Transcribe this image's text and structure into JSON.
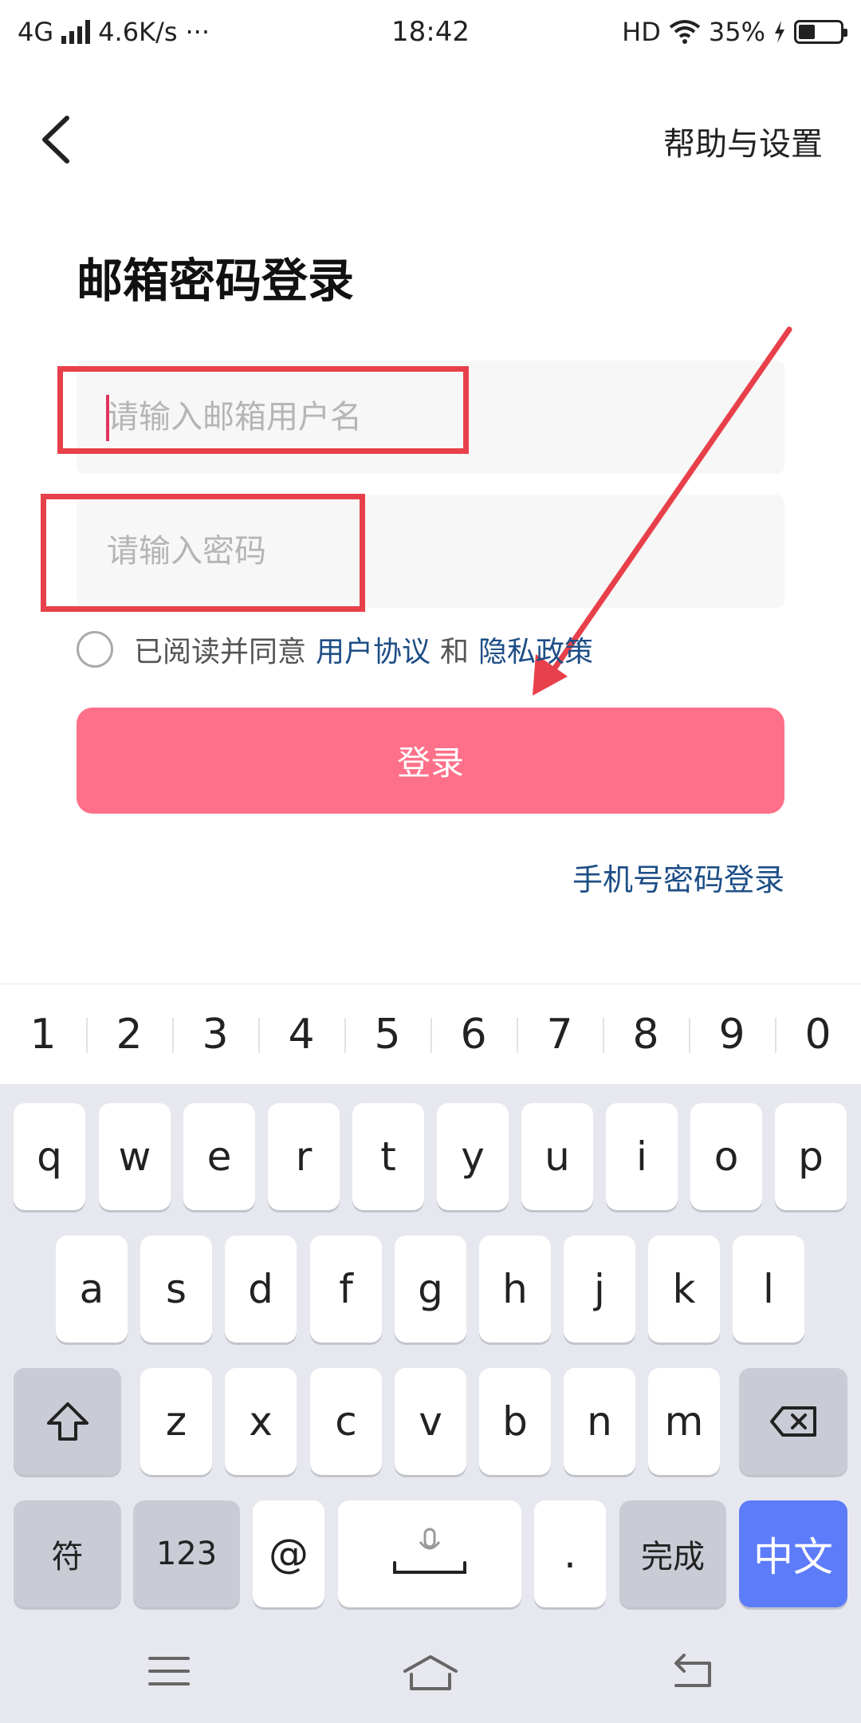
{
  "status_bar": {
    "network": "4G",
    "speed": "4.6K/s",
    "dots": "···",
    "time": "18:42",
    "hd": "HD",
    "battery": "35%"
  },
  "header": {
    "back_icon": "chevron-left-icon",
    "help_label": "帮助与设置"
  },
  "title": "邮箱密码登录",
  "form": {
    "email_placeholder": "请输入邮箱用户名",
    "password_placeholder": "请输入密码"
  },
  "agreement": {
    "prefix": "已阅读并同意",
    "user_agreement": "用户协议",
    "and": "和",
    "privacy_policy": "隐私政策"
  },
  "login_button": "登录",
  "phone_login_link": "手机号密码登录",
  "keyboard": {
    "numbers": [
      "1",
      "2",
      "3",
      "4",
      "5",
      "6",
      "7",
      "8",
      "9",
      "0"
    ],
    "row1": [
      "q",
      "w",
      "e",
      "r",
      "t",
      "y",
      "u",
      "i",
      "o",
      "p"
    ],
    "row2": [
      "a",
      "s",
      "d",
      "f",
      "g",
      "h",
      "j",
      "k",
      "l"
    ],
    "row3": [
      "z",
      "x",
      "c",
      "v",
      "b",
      "n",
      "m"
    ],
    "symbols_key": "符",
    "num_key": "123",
    "at_key": "@",
    "period_key": ".",
    "done_key": "完成",
    "lang_key": "中文",
    "shift_icon": "shift-icon",
    "backspace_icon": "backspace-icon",
    "mic_icon": "microphone-icon"
  },
  "colors": {
    "accent_pink": "#fe7089",
    "link_blue": "#1d4e86",
    "annotation_red": "#e8404a",
    "keyboard_blue": "#5d7cf9"
  }
}
